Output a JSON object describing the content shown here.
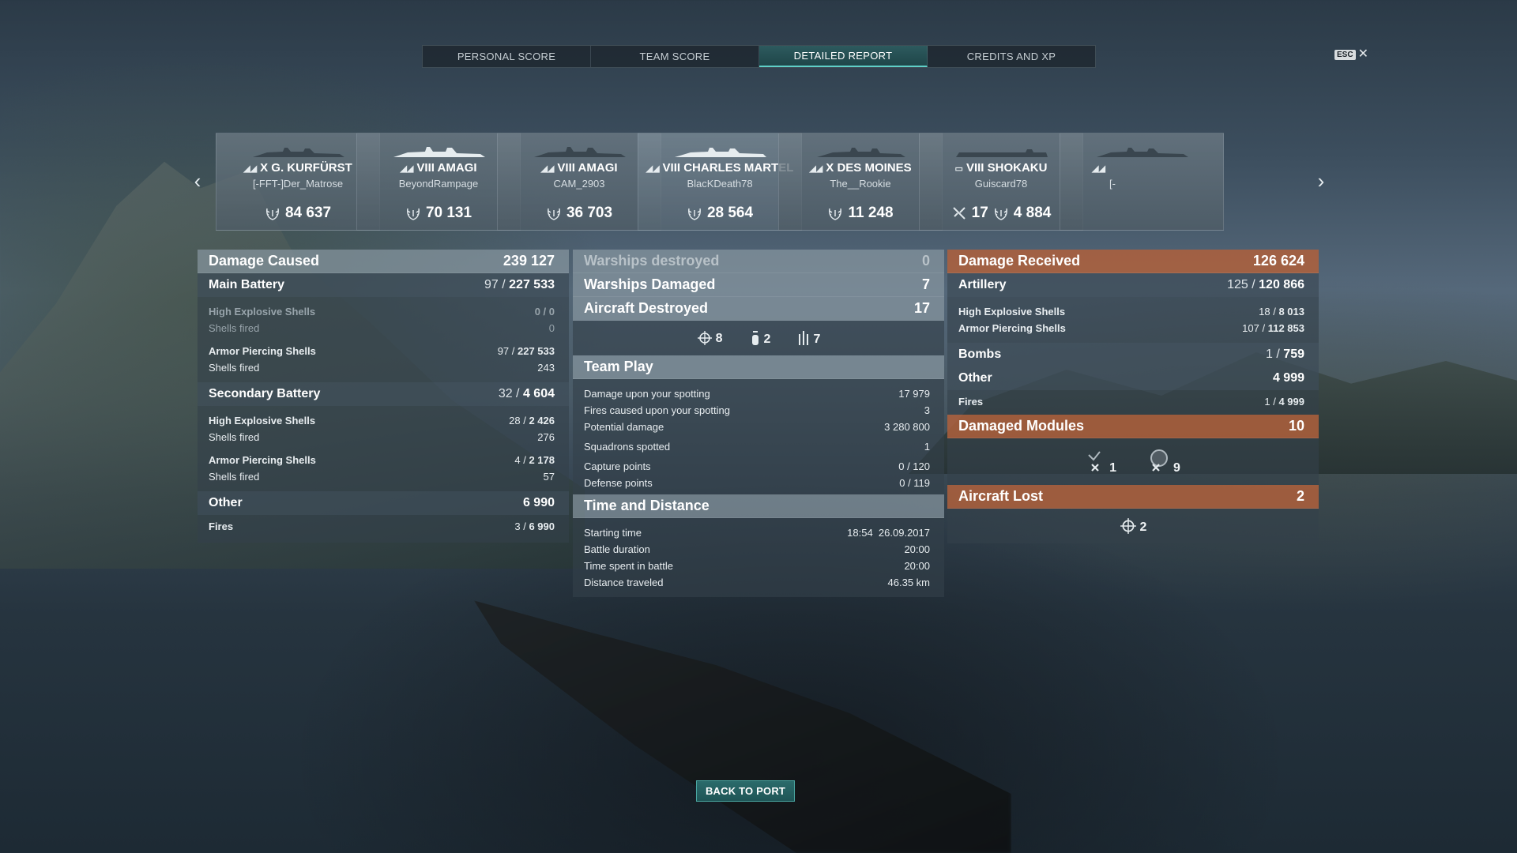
{
  "tabs": [
    {
      "label": "PERSONAL SCORE"
    },
    {
      "label": "TEAM SCORE"
    },
    {
      "label": "DETAILED REPORT"
    },
    {
      "label": "CREDITS AND XP"
    }
  ],
  "esc": {
    "key": "ESC",
    "close": "✕"
  },
  "carousel": {
    "prev_icon": "chevron-left-icon",
    "next_icon": "chevron-right-icon",
    "cards": [
      {
        "tier": "X",
        "ship": "G. KURFÜRST",
        "player": "[-FFT-]Der_Matrose",
        "score": "84 637"
      },
      {
        "tier": "VIII",
        "ship": "AMAGI",
        "player": "BeyondRampage",
        "score": "70 131"
      },
      {
        "tier": "VIII",
        "ship": "AMAGI",
        "player": "CAM_2903",
        "score": "36 703"
      },
      {
        "tier": "VIII",
        "ship": "CHARLES MARTEL",
        "player": "BlacKDeath78",
        "score": "28 564"
      },
      {
        "tier": "X",
        "ship": "DES MOINES",
        "player": "The__Rookie",
        "score": "11 248"
      },
      {
        "tier": "VIII",
        "ship": "SHOKAKU",
        "player": "Guiscard78",
        "score": "4 884",
        "planes": "17"
      },
      {
        "tier": "",
        "ship": "",
        "player": "[-",
        "score": ""
      }
    ]
  },
  "left": {
    "damage_caused": {
      "label": "Damage Caused",
      "value": "239 127"
    },
    "main_battery": {
      "label": "Main Battery",
      "a": "97",
      "b": "227 533"
    },
    "mb_he": {
      "label": "High Explosive Shells",
      "value": "0 / 0"
    },
    "mb_he_fired": {
      "label": "Shells fired",
      "value": "0"
    },
    "mb_ap": {
      "label": "Armor Piercing Shells",
      "a": "97",
      "b": "227 533"
    },
    "mb_ap_fired": {
      "label": "Shells fired",
      "value": "243"
    },
    "secondary": {
      "label": "Secondary Battery",
      "a": "32",
      "b": "4 604"
    },
    "sb_he": {
      "label": "High Explosive Shells",
      "a": "28",
      "b": "2 426"
    },
    "sb_he_fired": {
      "label": "Shells fired",
      "value": "276"
    },
    "sb_ap": {
      "label": "Armor Piercing Shells",
      "a": "4",
      "b": "2 178"
    },
    "sb_ap_fired": {
      "label": "Shells fired",
      "value": "57"
    },
    "other": {
      "label": "Other",
      "value": "6 990"
    },
    "fires": {
      "label": "Fires",
      "a": "3",
      "b": "6 990"
    }
  },
  "middle": {
    "warships_destroyed": {
      "label": "Warships destroyed",
      "value": "0"
    },
    "warships_damaged": {
      "label": "Warships Damaged",
      "value": "7"
    },
    "aircraft_destroyed": {
      "label": "Aircraft Destroyed",
      "value": "17"
    },
    "aircraft_icons": [
      {
        "icon": "fighter-crosshair-icon",
        "count": "8"
      },
      {
        "icon": "torpedo-bomber-icon",
        "count": "2"
      },
      {
        "icon": "dive-bomber-icon",
        "count": "7"
      }
    ],
    "team_play": {
      "label": "Team Play",
      "rows": [
        {
          "label": "Damage upon your spotting",
          "value": "17 979"
        },
        {
          "label": "Fires caused upon your spotting",
          "value": "3"
        },
        {
          "label": "Potential damage",
          "value": "3 280 800"
        },
        {
          "label": "Squadrons spotted",
          "value": "1"
        },
        {
          "label": "Capture points",
          "value": "0 / 120"
        },
        {
          "label": "Defense points",
          "value": "0 / 119"
        }
      ]
    },
    "time_distance": {
      "label": "Time and Distance",
      "rows": [
        {
          "label": "Starting time",
          "value": "18:54  26.09.2017"
        },
        {
          "label": "Battle duration",
          "value": "20:00"
        },
        {
          "label": "Time spent in battle",
          "value": "20:00"
        },
        {
          "label": "Distance traveled",
          "value": "46.35 km"
        }
      ]
    }
  },
  "right": {
    "damage_received": {
      "label": "Damage Received",
      "value": "126 624"
    },
    "artillery": {
      "label": "Artillery",
      "a": "125",
      "b": "120 866"
    },
    "art_he": {
      "label": "High Explosive Shells",
      "a": "18",
      "b": "8 013"
    },
    "art_ap": {
      "label": "Armor Piercing Shells",
      "a": "107",
      "b": "112 853"
    },
    "bombs": {
      "label": "Bombs",
      "a": "1",
      "b": "759"
    },
    "other": {
      "label": "Other",
      "value": "4 999"
    },
    "fires": {
      "label": "Fires",
      "a": "1",
      "b": "4 999"
    },
    "damaged_modules": {
      "label": "Damaged Modules",
      "value": "10"
    },
    "module_icons": [
      {
        "icon": "steering-gear-icon",
        "count": "1"
      },
      {
        "icon": "turret-icon",
        "count": "9"
      }
    ],
    "aircraft_lost": {
      "label": "Aircraft Lost",
      "value": "2"
    },
    "lost_icons": [
      {
        "icon": "fighter-crosshair-icon",
        "count": "2"
      }
    ]
  },
  "back_button": "BACK TO PORT"
}
